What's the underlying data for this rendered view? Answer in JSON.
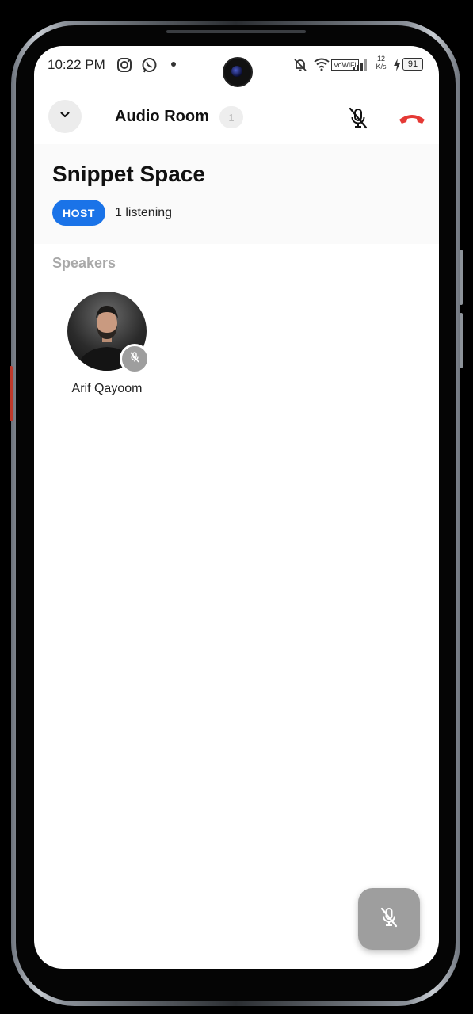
{
  "status_bar": {
    "time": "10:22 PM",
    "net_speed": "12",
    "net_unit": "K/s",
    "battery": "91",
    "vowifi": "VoWiFi"
  },
  "appbar": {
    "title": "Audio Room",
    "participant_count": "1"
  },
  "room": {
    "name": "Snippet Space",
    "role_badge": "HOST",
    "listening": "1 listening"
  },
  "speakers": {
    "label": "Speakers",
    "items": [
      {
        "name": "Arif Qayoom",
        "muted": true
      }
    ]
  },
  "colors": {
    "accent": "#1a73e8",
    "hangup": "#e53935",
    "muted_gray": "#9e9e9e"
  },
  "icons": [
    "chevron-down-icon",
    "mic-off-icon",
    "call-end-icon",
    "instagram-icon",
    "whatsapp-icon",
    "bell-off-icon",
    "wifi-icon",
    "signal-icon",
    "battery-icon"
  ]
}
